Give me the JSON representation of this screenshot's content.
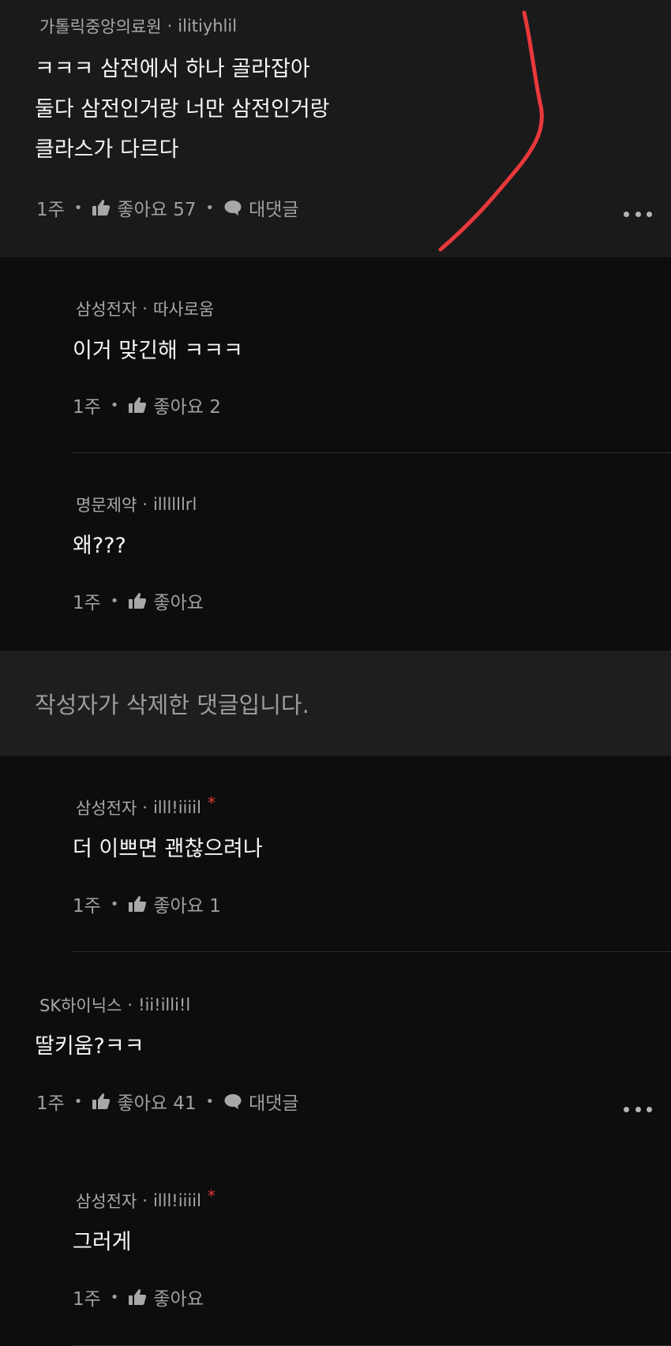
{
  "comments": [
    {
      "author": "가톨릭중앙의료원",
      "handle": "ilitiyhlil",
      "lines": [
        "ㅋㅋㅋ 삼전에서 하나 골라잡아",
        "둘다 삼전인거랑 너만 삼전인거랑",
        "클라스가 다르다"
      ],
      "time": "1주",
      "like_label": "좋아요 57",
      "reply_label": "대댓글"
    },
    {
      "author": "삼성전자",
      "handle": "따사로움",
      "lines": [
        "이거 맞긴해 ㅋㅋㅋ"
      ],
      "time": "1주",
      "like_label": "좋아요 2"
    },
    {
      "author": "명문제약",
      "handle": "illllllrl",
      "lines": [
        "왜???"
      ],
      "time": "1주",
      "like_label": "좋아요"
    },
    {
      "deleted_text": "작성자가 삭제한 댓글입니다."
    },
    {
      "author": "삼성전자",
      "handle": "illl!iiiil",
      "star": "*",
      "lines": [
        "더 이쁘면 괜찮으려나"
      ],
      "time": "1주",
      "like_label": "좋아요 1"
    },
    {
      "author": "SK하이닉스",
      "handle": "!ii!illi!l",
      "lines": [
        "딸키움?ㅋㅋ"
      ],
      "time": "1주",
      "like_label": "좋아요 41",
      "reply_label": "대댓글"
    },
    {
      "author": "삼성전자",
      "handle": "illl!iiiil",
      "star": "*",
      "lines": [
        "그러게"
      ],
      "time": "1주",
      "like_label": "좋아요"
    }
  ],
  "separator_dot": "•",
  "meta_dot": "·",
  "icons": {
    "like": "thumbs-up-icon",
    "reply": "speech-bubble-icon",
    "more": "more-dots-icon"
  },
  "colors": {
    "annotation": "#e8383b",
    "star": "#e03a3a"
  }
}
